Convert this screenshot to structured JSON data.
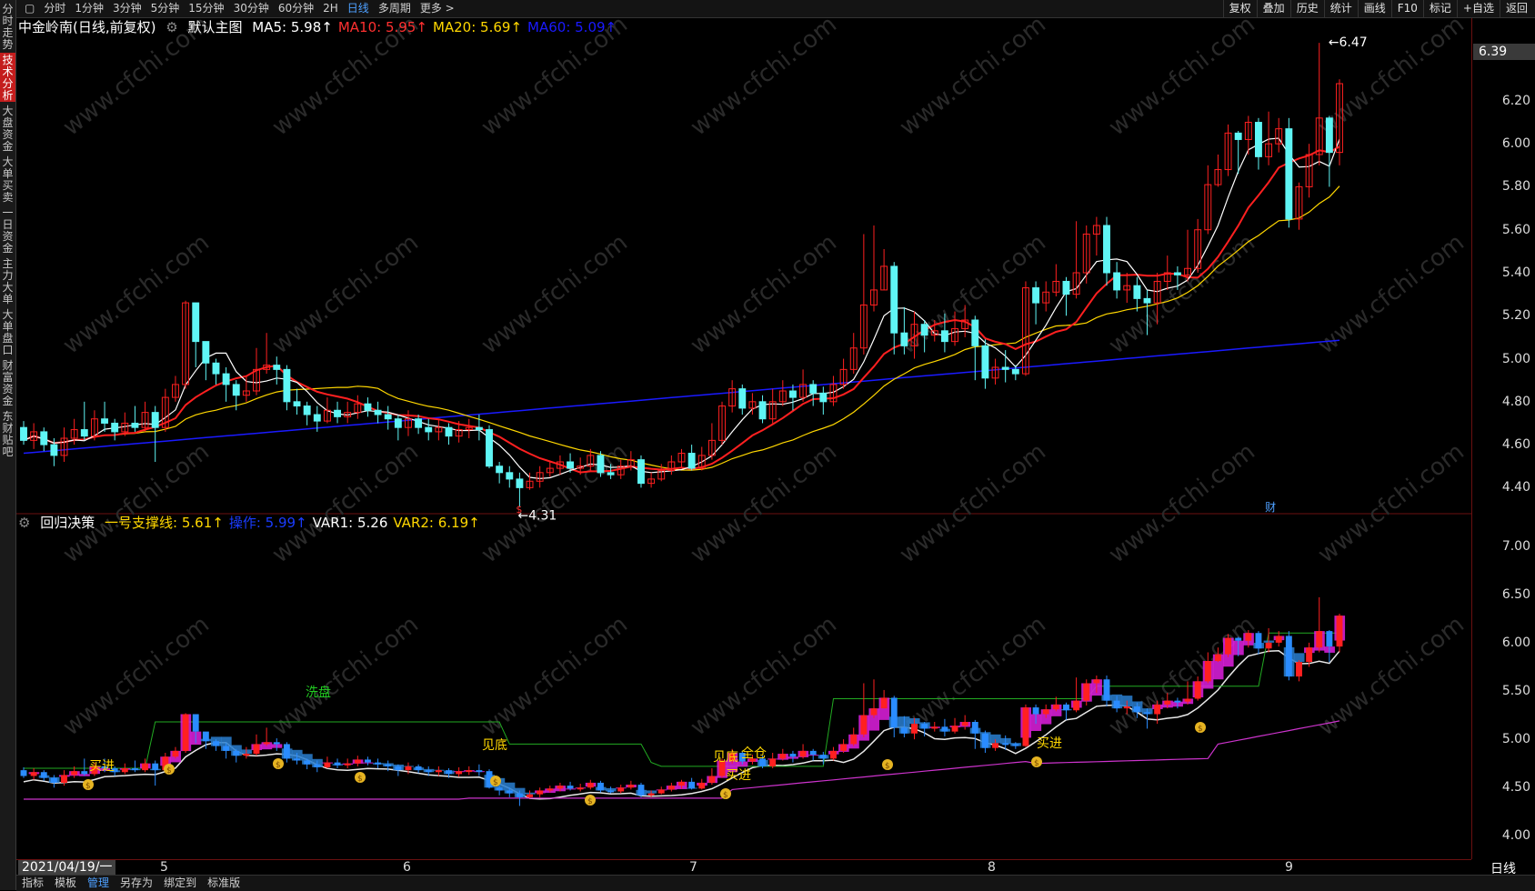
{
  "left_tabs": [
    {
      "label": "分时走势",
      "active": false
    },
    {
      "label": "技术分析",
      "active": true
    },
    {
      "label": "大盘资金",
      "active": false
    },
    {
      "label": "大单买卖",
      "active": false
    },
    {
      "label": "一日资金",
      "active": false
    },
    {
      "label": "主力大单",
      "active": false
    },
    {
      "label": "大单盘口",
      "active": false
    },
    {
      "label": "财富资金",
      "active": false
    },
    {
      "label": "东财贴吧",
      "active": false
    }
  ],
  "toolbar": {
    "periods": [
      "分时",
      "1分钟",
      "3分钟",
      "5分钟",
      "15分钟",
      "30分钟",
      "60分钟",
      "2H",
      "日线",
      "多周期",
      "更多 >"
    ],
    "selected_period": "日线",
    "right": [
      "复权",
      "叠加",
      "历史",
      "统计",
      "画线",
      "F10",
      "标记",
      "+自选",
      "返回"
    ]
  },
  "main_legend": {
    "title": "中金岭南(日线,前复权)",
    "template": "默认主图",
    "items": [
      {
        "text": "MA5: 5.98↑",
        "color": "#ffffff"
      },
      {
        "text": "MA10: 5.95↑",
        "color": "#ff3030"
      },
      {
        "text": "MA20: 5.69↑",
        "color": "#ffd700"
      },
      {
        "text": "MA60: 5.09↑",
        "color": "#1a1aff"
      }
    ]
  },
  "sub_legend": {
    "title": "回归决策",
    "items": [
      {
        "text": "一号支撑线: 5.61↑",
        "color": "#ffd700"
      },
      {
        "text": "操作: 5.99↑",
        "color": "#1a3cff"
      },
      {
        "text": "VAR1: 5.26",
        "color": "#ffffff"
      },
      {
        "text": "VAR2: 6.19↑",
        "color": "#ffd700"
      }
    ]
  },
  "main_axis": {
    "ticks": [
      "6.39",
      "6.20",
      "6.00",
      "5.80",
      "5.60",
      "5.40",
      "5.20",
      "5.00",
      "4.80",
      "4.60",
      "4.40"
    ],
    "current_price": "6.39"
  },
  "sub_axis": {
    "ticks": [
      "7.00",
      "6.50",
      "6.00",
      "5.50",
      "5.00",
      "4.50",
      "4.00"
    ]
  },
  "x_axis": {
    "date": "2021/04/19/一",
    "months": [
      "5",
      "6",
      "7",
      "8",
      "9"
    ],
    "period_button": "日线"
  },
  "annotations": {
    "high": "6.47",
    "low": "4.31",
    "cai_label": "财",
    "s_label": "$"
  },
  "signals": {
    "xipan": "洗盘",
    "jiandi1": "见底",
    "jiandi2": "见底",
    "quancang": "全仓",
    "maijin1": "买进",
    "maijin2": "买进",
    "maijin3": "买进"
  },
  "bottom_tabs": [
    "指标",
    "模板",
    "管理",
    "另存为",
    "绑定到",
    "标准版"
  ],
  "bottom_selected": "管理",
  "watermark": "www.cfchi.com",
  "colors": {
    "up": "#ff2020",
    "down": "#5ff5f5",
    "ma5": "#ffffff",
    "ma10": "#ff2020",
    "ma20": "#ffd700",
    "ma60": "#1a1aff"
  },
  "chart_data": {
    "type": "candlestick",
    "title": "中金岭南(日线,前复权)",
    "ylim": [
      4.3,
      6.5
    ],
    "candles": [
      [
        4.68,
        4.62,
        4.71,
        4.6
      ],
      [
        4.62,
        4.66,
        4.7,
        4.58
      ],
      [
        4.66,
        4.6,
        4.68,
        4.57
      ],
      [
        4.6,
        4.55,
        4.63,
        4.5
      ],
      [
        4.55,
        4.63,
        4.68,
        4.52
      ],
      [
        4.63,
        4.67,
        4.72,
        4.6
      ],
      [
        4.67,
        4.64,
        4.8,
        4.62
      ],
      [
        4.64,
        4.72,
        4.76,
        4.62
      ],
      [
        4.72,
        4.7,
        4.8,
        4.66
      ],
      [
        4.7,
        4.66,
        4.72,
        4.62
      ],
      [
        4.66,
        4.7,
        4.75,
        4.64
      ],
      [
        4.7,
        4.68,
        4.78,
        4.66
      ],
      [
        4.68,
        4.75,
        4.8,
        4.66
      ],
      [
        4.75,
        4.68,
        4.78,
        4.52
      ],
      [
        4.68,
        4.82,
        4.86,
        4.66
      ],
      [
        4.82,
        4.88,
        4.92,
        4.8
      ],
      [
        4.88,
        5.26,
        5.27,
        4.86
      ],
      [
        5.26,
        5.08,
        5.1,
        4.96
      ],
      [
        5.08,
        4.98,
        5.05,
        4.9
      ],
      [
        4.98,
        4.93,
        5.0,
        4.88
      ],
      [
        4.93,
        4.88,
        4.96,
        4.8
      ],
      [
        4.88,
        4.83,
        4.9,
        4.76
      ],
      [
        4.83,
        4.85,
        4.92,
        4.8
      ],
      [
        4.85,
        4.95,
        5.05,
        4.83
      ],
      [
        4.95,
        4.97,
        5.12,
        4.93
      ],
      [
        4.97,
        4.95,
        5.01,
        4.88
      ],
      [
        4.95,
        4.8,
        4.97,
        4.76
      ],
      [
        4.8,
        4.78,
        4.86,
        4.74
      ],
      [
        4.78,
        4.74,
        4.8,
        4.69
      ],
      [
        4.74,
        4.71,
        4.78,
        4.66
      ],
      [
        4.71,
        4.76,
        4.82,
        4.7
      ],
      [
        4.76,
        4.73,
        4.8,
        4.7
      ],
      [
        4.73,
        4.75,
        4.8,
        4.7
      ],
      [
        4.75,
        4.79,
        4.83,
        4.72
      ],
      [
        4.79,
        4.76,
        4.82,
        4.73
      ],
      [
        4.76,
        4.74,
        4.8,
        4.7
      ],
      [
        4.74,
        4.72,
        4.78,
        4.67
      ],
      [
        4.72,
        4.68,
        4.74,
        4.62
      ],
      [
        4.68,
        4.72,
        4.76,
        4.64
      ],
      [
        4.72,
        4.68,
        4.74,
        4.65
      ],
      [
        4.68,
        4.66,
        4.72,
        4.62
      ],
      [
        4.66,
        4.68,
        4.72,
        4.62
      ],
      [
        4.68,
        4.64,
        4.7,
        4.6
      ],
      [
        4.64,
        4.67,
        4.71,
        4.61
      ],
      [
        4.67,
        4.68,
        4.72,
        4.63
      ],
      [
        4.68,
        4.67,
        4.74,
        4.62
      ],
      [
        4.67,
        4.5,
        4.69,
        4.49
      ],
      [
        4.5,
        4.47,
        4.52,
        4.42
      ],
      [
        4.47,
        4.44,
        4.5,
        4.4
      ],
      [
        4.44,
        4.4,
        4.47,
        4.31
      ],
      [
        4.4,
        4.43,
        4.47,
        4.39
      ],
      [
        4.43,
        4.47,
        4.5,
        4.4
      ],
      [
        4.47,
        4.49,
        4.52,
        4.45
      ],
      [
        4.49,
        4.52,
        4.55,
        4.46
      ],
      [
        4.52,
        4.49,
        4.56,
        4.47
      ],
      [
        4.49,
        4.5,
        4.54,
        4.46
      ],
      [
        4.5,
        4.55,
        4.58,
        4.48
      ],
      [
        4.55,
        4.47,
        4.57,
        4.45
      ],
      [
        4.47,
        4.46,
        4.51,
        4.44
      ],
      [
        4.46,
        4.5,
        4.53,
        4.44
      ],
      [
        4.5,
        4.53,
        4.57,
        4.48
      ],
      [
        4.53,
        4.42,
        4.55,
        4.4
      ],
      [
        4.42,
        4.44,
        4.47,
        4.4
      ],
      [
        4.44,
        4.48,
        4.51,
        4.43
      ],
      [
        4.48,
        4.52,
        4.55,
        4.46
      ],
      [
        4.52,
        4.56,
        4.58,
        4.49
      ],
      [
        4.56,
        4.49,
        4.6,
        4.48
      ],
      [
        4.49,
        4.55,
        4.59,
        4.48
      ],
      [
        4.55,
        4.62,
        4.7,
        4.53
      ],
      [
        4.62,
        4.78,
        4.8,
        4.6
      ],
      [
        4.78,
        4.86,
        4.9,
        4.75
      ],
      [
        4.86,
        4.77,
        4.88,
        4.74
      ],
      [
        4.77,
        4.8,
        4.84,
        4.74
      ],
      [
        4.8,
        4.72,
        4.83,
        4.7
      ],
      [
        4.72,
        4.8,
        4.86,
        4.7
      ],
      [
        4.8,
        4.85,
        4.9,
        4.78
      ],
      [
        4.85,
        4.82,
        4.88,
        4.76
      ],
      [
        4.82,
        4.88,
        4.95,
        4.8
      ],
      [
        4.88,
        4.84,
        4.9,
        4.78
      ],
      [
        4.84,
        4.8,
        4.87,
        4.74
      ],
      [
        4.8,
        4.88,
        4.92,
        4.78
      ],
      [
        4.88,
        4.95,
        5.0,
        4.86
      ],
      [
        4.95,
        5.05,
        5.12,
        4.93
      ],
      [
        5.05,
        5.25,
        5.58,
        5.02
      ],
      [
        5.25,
        5.32,
        5.62,
        5.22
      ],
      [
        5.32,
        5.43,
        5.51,
        5.32
      ],
      [
        5.43,
        5.12,
        5.45,
        5.02
      ],
      [
        5.12,
        5.06,
        5.24,
        5.02
      ],
      [
        5.06,
        5.16,
        5.22,
        5.0
      ],
      [
        5.16,
        5.11,
        5.18,
        5.03
      ],
      [
        5.11,
        5.13,
        5.18,
        5.08
      ],
      [
        5.13,
        5.08,
        5.21,
        5.03
      ],
      [
        5.08,
        5.14,
        5.22,
        5.06
      ],
      [
        5.14,
        5.18,
        5.25,
        5.1
      ],
      [
        5.18,
        5.06,
        5.2,
        4.9
      ],
      [
        5.06,
        4.91,
        5.09,
        4.86
      ],
      [
        4.91,
        4.96,
        5.0,
        4.88
      ],
      [
        4.96,
        4.95,
        5.04,
        4.89
      ],
      [
        4.95,
        4.93,
        4.97,
        4.9
      ],
      [
        4.93,
        5.33,
        5.36,
        4.92
      ],
      [
        5.33,
        5.26,
        5.36,
        5.16
      ],
      [
        5.26,
        5.31,
        5.36,
        5.22
      ],
      [
        5.31,
        5.36,
        5.44,
        5.29
      ],
      [
        5.36,
        5.3,
        5.38,
        5.2
      ],
      [
        5.3,
        5.4,
        5.64,
        5.28
      ],
      [
        5.4,
        5.58,
        5.62,
        5.35
      ],
      [
        5.58,
        5.62,
        5.66,
        5.48
      ],
      [
        5.62,
        5.4,
        5.66,
        5.34
      ],
      [
        5.4,
        5.32,
        5.45,
        5.28
      ],
      [
        5.32,
        5.34,
        5.4,
        5.26
      ],
      [
        5.34,
        5.28,
        5.38,
        5.22
      ],
      [
        5.28,
        5.26,
        5.32,
        5.11
      ],
      [
        5.26,
        5.36,
        5.4,
        5.16
      ],
      [
        5.36,
        5.4,
        5.48,
        5.32
      ],
      [
        5.4,
        5.39,
        5.43,
        5.32
      ],
      [
        5.39,
        5.42,
        5.6,
        5.36
      ],
      [
        5.42,
        5.6,
        5.65,
        5.4
      ],
      [
        5.6,
        5.81,
        5.9,
        5.58
      ],
      [
        5.81,
        5.88,
        5.95,
        5.8
      ],
      [
        5.88,
        6.05,
        6.09,
        5.85
      ],
      [
        6.05,
        6.02,
        6.06,
        5.86
      ],
      [
        6.02,
        6.1,
        6.13,
        5.95
      ],
      [
        6.1,
        5.94,
        6.12,
        5.88
      ],
      [
        5.94,
        6.0,
        6.15,
        5.9
      ],
      [
        6.0,
        6.07,
        6.12,
        5.96
      ],
      [
        6.07,
        5.65,
        6.12,
        5.61
      ],
      [
        5.65,
        5.8,
        5.82,
        5.6
      ],
      [
        5.8,
        5.95,
        6.0,
        5.75
      ],
      [
        5.95,
        6.12,
        6.47,
        5.9
      ],
      [
        6.12,
        5.96,
        6.13,
        5.8
      ],
      [
        5.96,
        6.28,
        6.3,
        5.9
      ]
    ]
  }
}
